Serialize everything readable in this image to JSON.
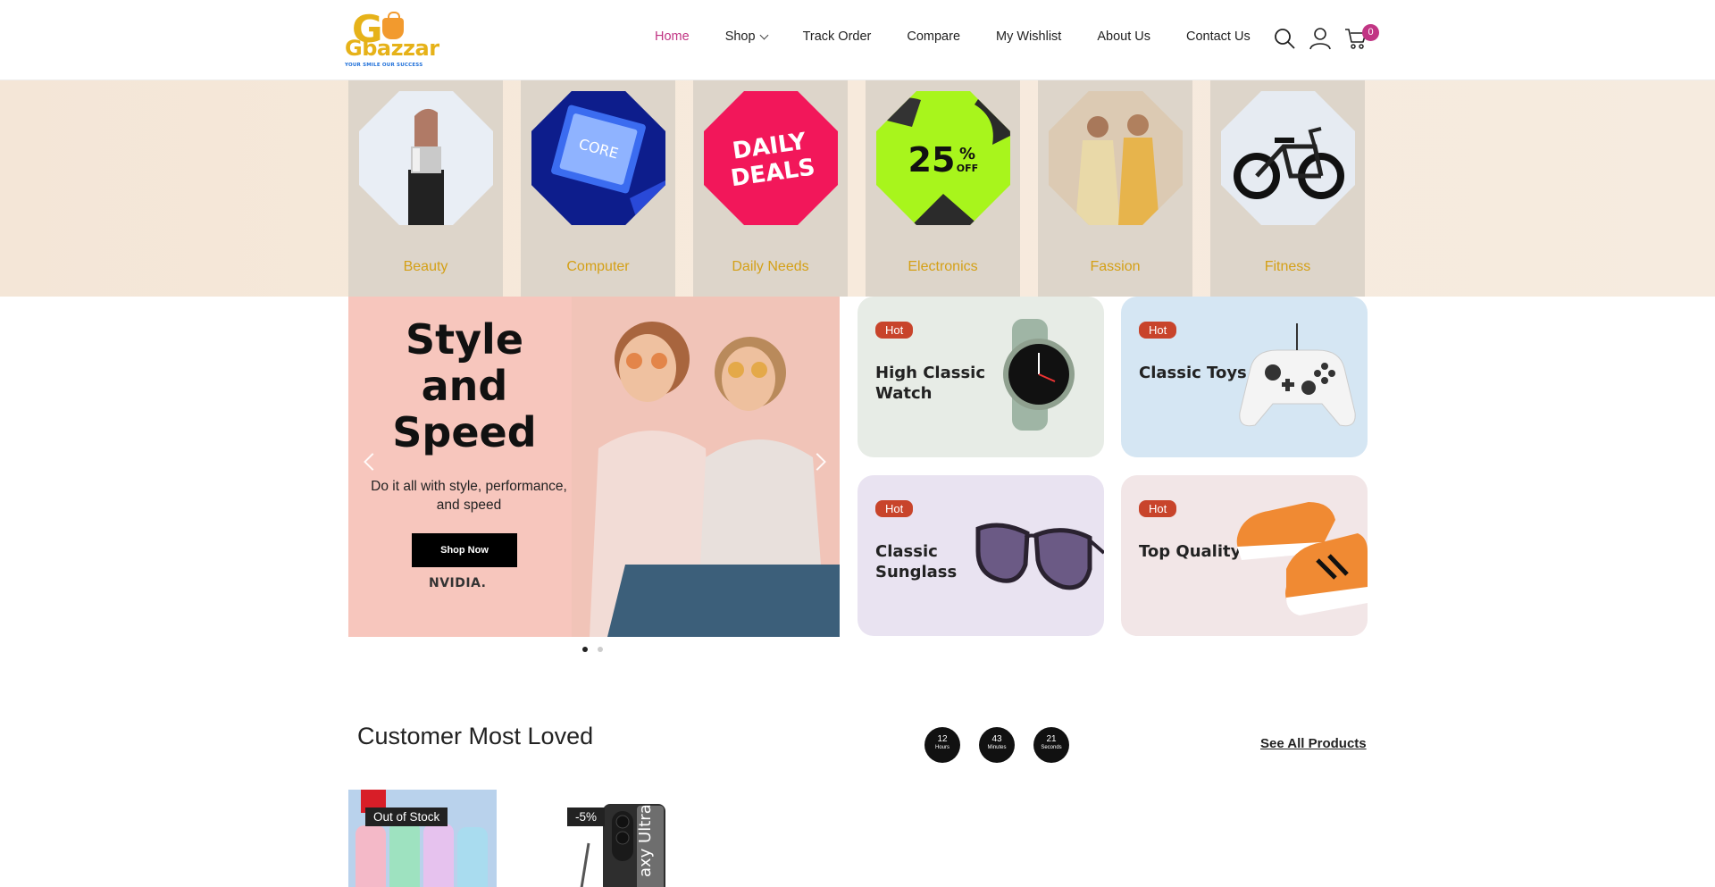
{
  "brand": {
    "name": "Gbazzar",
    "tagline": "YOUR SMILE OUR SUCCESS"
  },
  "nav": {
    "items": [
      {
        "label": "Home",
        "active": true
      },
      {
        "label": "Shop",
        "dropdown": true
      },
      {
        "label": "Track Order"
      },
      {
        "label": "Compare"
      },
      {
        "label": "My Wishlist"
      },
      {
        "label": "About Us"
      },
      {
        "label": "Contact Us"
      }
    ],
    "cart_count": "0",
    "icons": [
      "search-icon",
      "user-icon",
      "cart-icon"
    ]
  },
  "categories": [
    {
      "label": "Beauty",
      "icon": "lipstick-image"
    },
    {
      "label": "Computer",
      "icon": "cpu-chip-image"
    },
    {
      "label": "Daily Needs",
      "icon": "daily-deals-image",
      "art_text": "DAILY DEALS"
    },
    {
      "label": "Electronics",
      "icon": "electronics-sale-image",
      "art_text": "25% OFF"
    },
    {
      "label": "Fassion",
      "icon": "fashion-models-image"
    },
    {
      "label": "Fitness",
      "icon": "ebike-image"
    }
  ],
  "hero": {
    "title": "Style and Speed",
    "subtitle": "Do it all with style, performance, and speed",
    "button": "Shop Now",
    "brand": "NVIDIA.",
    "slides": 2,
    "active_slide": 1
  },
  "promos": [
    {
      "badge": "Hot",
      "title": "High Classic Watch",
      "bg": "#e7ece6"
    },
    {
      "badge": "Hot",
      "title": "Classic Toys",
      "bg": "#d5e6f3"
    },
    {
      "badge": "Hot",
      "title": "Classic Sunglass",
      "bg": "#e9e3f1"
    },
    {
      "badge": "Hot",
      "title": "Top Quality",
      "bg": "#f2e6e7"
    }
  ],
  "section": {
    "title": "Customer Most Loved",
    "timer": [
      {
        "value": "12",
        "unit": "Hours"
      },
      {
        "value": "43",
        "unit": "Minutes"
      },
      {
        "value": "21",
        "unit": "Seconds"
      }
    ],
    "see_all": "See All Products"
  },
  "products": [
    {
      "badge": "Out of Stock"
    },
    {
      "badge": "-5%",
      "art_text": "axy Ultra"
    }
  ],
  "colors": {
    "accent": "#c13584",
    "category_label": "#d4a017",
    "hot_badge": "#c8442b"
  }
}
